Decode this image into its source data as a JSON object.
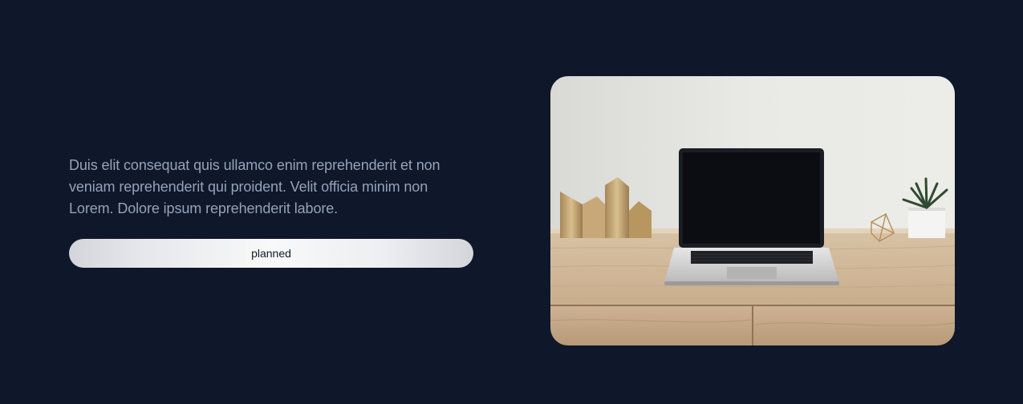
{
  "hero": {
    "description": "Duis elit consequat quis ullamco enim reprehenderit et non veniam reprehenderit qui proident. Velit officia minim non Lorem. Dolore ipsum reprehenderit labore.",
    "button_label": "planned"
  },
  "image": {
    "subject": "laptop-on-wooden-desk"
  },
  "colors": {
    "background": "#0f172a",
    "text_muted": "#94a3b8",
    "button_text": "#111827"
  }
}
